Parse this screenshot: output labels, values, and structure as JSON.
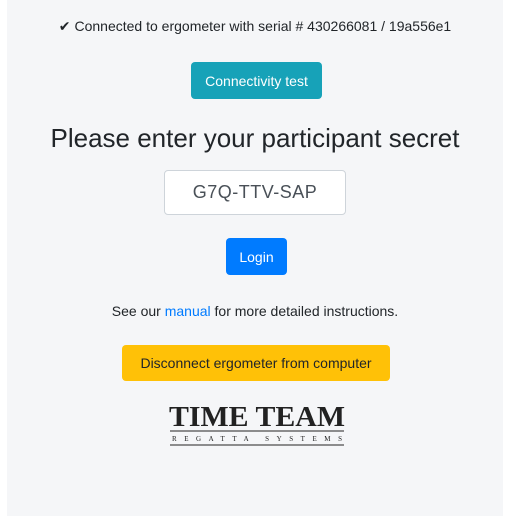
{
  "status": {
    "icon": "check-icon",
    "text": "Connected to ergometer with serial # 430266081 / 19a556e1"
  },
  "buttons": {
    "connectivity_test": "Connectivity test",
    "login": "Login",
    "disconnect": "Disconnect ergometer from computer"
  },
  "heading": "Please enter your participant secret",
  "secret_input": {
    "value": "G7Q-TTV-SAP"
  },
  "instructions": {
    "before": "See our ",
    "link": "manual",
    "after": " for more detailed instructions."
  },
  "logo": {
    "title": "TIME TEAM",
    "subtitle": "REGATTA SYSTEMS"
  },
  "colors": {
    "panel_bg": "#f5f6f8",
    "info": "#17a2b8",
    "primary": "#007bff",
    "warning": "#ffc107",
    "link": "#007bff"
  }
}
